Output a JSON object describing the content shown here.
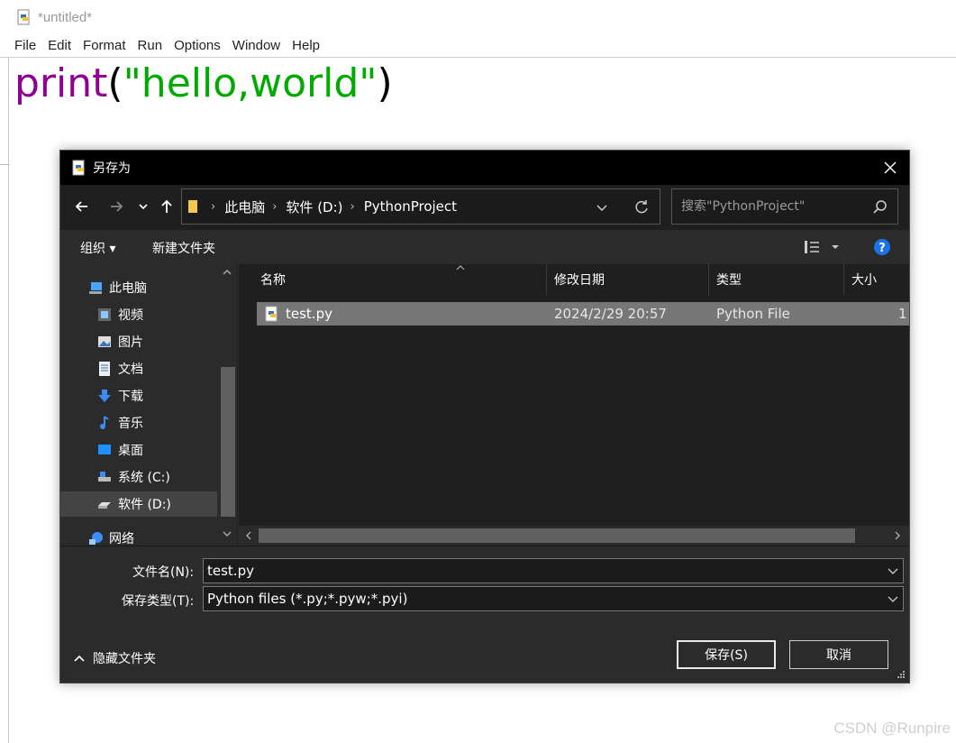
{
  "idle": {
    "title": "*untitled*",
    "menu": [
      "File",
      "Edit",
      "Format",
      "Run",
      "Options",
      "Window",
      "Help"
    ],
    "code": {
      "keyword": "print",
      "open": "(",
      "string": "\"hello,world\"",
      "close": ")"
    }
  },
  "watermark": "CSDN @Runpire",
  "dialog": {
    "title": "另存为",
    "breadcrumb": [
      "此电脑",
      "软件 (D:)",
      "PythonProject"
    ],
    "search_placeholder": "搜索\"PythonProject\"",
    "toolbar": {
      "organize": "组织 ▾",
      "new_folder": "新建文件夹"
    },
    "sidebar": [
      {
        "label": "此电脑",
        "icon": "computer-icon",
        "indent": 0
      },
      {
        "label": "视频",
        "icon": "video-icon",
        "indent": 1
      },
      {
        "label": "图片",
        "icon": "picture-icon",
        "indent": 1
      },
      {
        "label": "文档",
        "icon": "document-icon",
        "indent": 1
      },
      {
        "label": "下载",
        "icon": "download-icon",
        "indent": 1
      },
      {
        "label": "音乐",
        "icon": "music-icon",
        "indent": 1
      },
      {
        "label": "桌面",
        "icon": "desktop-icon",
        "indent": 1
      },
      {
        "label": "系统 (C:)",
        "icon": "system-drive-icon",
        "indent": 1
      },
      {
        "label": "软件 (D:)",
        "icon": "drive-icon",
        "indent": 1,
        "selected": true
      },
      {
        "label": "网络",
        "icon": "network-icon",
        "indent": 0
      }
    ],
    "columns": [
      "名称",
      "修改日期",
      "类型",
      "大小"
    ],
    "files": [
      {
        "name": "test.py",
        "modified": "2024/2/29 20:57",
        "type": "Python File",
        "size": "1"
      }
    ],
    "filename_label": "文件名(N):",
    "filename_value": "test.py",
    "filetype_label": "保存类型(T):",
    "filetype_value": "Python files (*.py;*.pyw;*.pyi)",
    "hide_folders": "隐藏文件夹",
    "save_button": "保存(S)",
    "cancel_button": "取消"
  }
}
